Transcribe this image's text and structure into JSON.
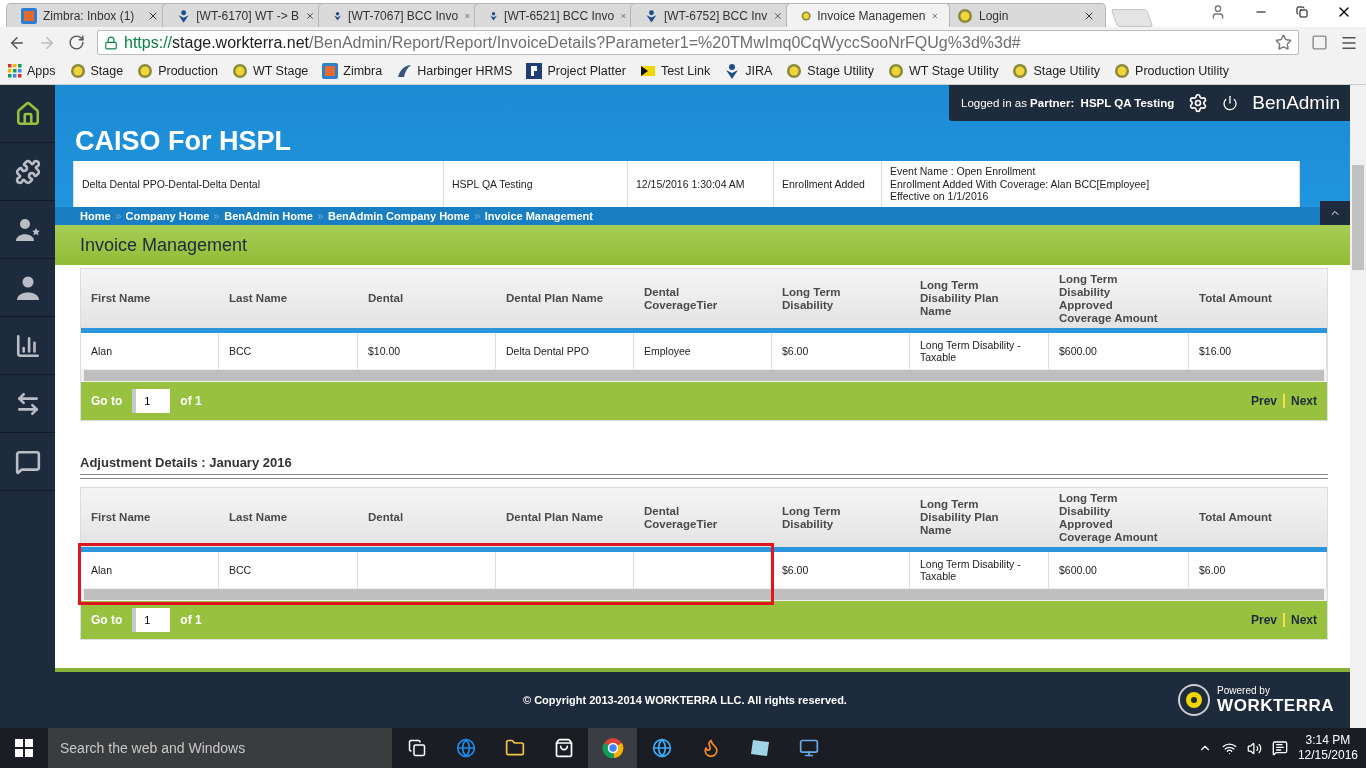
{
  "browser": {
    "tabs": [
      {
        "title": "Zimbra: Inbox (1)",
        "kind": "zimbra",
        "selected": false
      },
      {
        "title": "[WT-6170] WT -> B",
        "kind": "jira",
        "selected": false
      },
      {
        "title": "[WT-7067] BCC Invo",
        "kind": "jira",
        "selected": false
      },
      {
        "title": "[WT-6521] BCC Invo",
        "kind": "jira",
        "selected": false
      },
      {
        "title": "[WT-6752] BCC Inv",
        "kind": "jira",
        "selected": false
      },
      {
        "title": "Invoice Managemen",
        "kind": "site",
        "selected": true
      },
      {
        "title": "Login",
        "kind": "site",
        "selected": false
      }
    ],
    "url": {
      "scheme": "https://",
      "host": "stage.workterra.net",
      "path": "/BenAdmin/Report/Report/InvoiceDetails?Parameter1=%20TMwImq0CqWyccSooNrFQUg%3d%3d#"
    },
    "bookmarks": [
      {
        "label": "Apps",
        "kind": "apps"
      },
      {
        "label": "Stage",
        "kind": "site"
      },
      {
        "label": "Production",
        "kind": "site"
      },
      {
        "label": "WT Stage",
        "kind": "site"
      },
      {
        "label": "Zimbra",
        "kind": "zimbra"
      },
      {
        "label": "Harbinger HRMS",
        "kind": "harbinger"
      },
      {
        "label": "Project Platter",
        "kind": "letter"
      },
      {
        "label": "Test Link",
        "kind": "testlink"
      },
      {
        "label": "JIRA",
        "kind": "jira"
      },
      {
        "label": "Stage Utility",
        "kind": "site"
      },
      {
        "label": "WT Stage Utility",
        "kind": "site"
      },
      {
        "label": "Stage Utility",
        "kind": "site"
      },
      {
        "label": "Production Utility",
        "kind": "site"
      }
    ]
  },
  "sidebar": {
    "items": [
      {
        "kind": "home",
        "selected": true
      },
      {
        "kind": "puzzle",
        "selected": false
      },
      {
        "kind": "user-star",
        "selected": false
      },
      {
        "kind": "user",
        "selected": false
      },
      {
        "kind": "chart",
        "selected": false
      },
      {
        "kind": "transfer",
        "selected": false
      },
      {
        "kind": "chat",
        "selected": false
      }
    ]
  },
  "header": {
    "site_title": "CAISO For HSPL",
    "login_prefix": "Logged in as",
    "login_role": "Partner:",
    "login_name": "HSPL QA Testing",
    "app_name": "BenAdmin"
  },
  "notification": {
    "cells": [
      [
        "Delta Dental PPO-Dental-Delta Dental"
      ],
      [
        "HSPL QA Testing"
      ],
      [
        "12/15/2016 1:30:04 AM"
      ],
      [
        "Enrollment Added"
      ],
      [
        "Event Name : Open Enrollment",
        "Enrollment Added With Coverage: Alan BCC[Employee]",
        "Effective on 1/1/2016"
      ]
    ]
  },
  "breadcrumb": [
    "Home",
    "Company Home",
    "BenAdmin Home",
    "BenAdmin Company Home",
    "Invoice Management"
  ],
  "section_title": "Invoice Management",
  "invoice_table": {
    "columns": [
      "First Name",
      "Last Name",
      "Dental",
      "Dental Plan Name",
      "Dental CoverageTier",
      "Long Term Disability",
      "Long Term Disability Plan Name",
      "Long Term Disability Approved Coverage Amount",
      "Total Amount"
    ],
    "rows": [
      {
        "highlighted": false,
        "cells": [
          "Alan",
          "BCC",
          "$10.00",
          "Delta Dental PPO",
          "Employee",
          "$6.00",
          "Long Term Disability - Taxable",
          "$600.00",
          "$16.00"
        ]
      }
    ],
    "pager": {
      "goto_label": "Go to",
      "page": "1",
      "of_label": "of 1",
      "prev": "Prev",
      "next": "Next"
    }
  },
  "adjustment": {
    "title": "Adjustment Details : January 2016",
    "table": {
      "columns": [
        "First Name",
        "Last Name",
        "Dental",
        "Dental Plan Name",
        "Dental CoverageTier",
        "Long Term Disability",
        "Long Term Disability Plan Name",
        "Long Term Disability Approved Coverage Amount",
        "Total Amount"
      ],
      "rows": [
        {
          "highlighted": true,
          "cells": [
            "Alan",
            "BCC",
            "",
            "",
            "",
            "$6.00",
            "Long Term Disability - Taxable",
            "$600.00",
            "$6.00"
          ]
        }
      ],
      "pager": {
        "goto_label": "Go to",
        "page": "1",
        "of_label": "of 1",
        "prev": "Prev",
        "next": "Next"
      }
    }
  },
  "footer": {
    "copyright": "© Copyright 2013-2014 WORKTERRA LLC. All rights reserved.",
    "powered_label": "Powered by",
    "powered_brand": "WORKTERRA"
  },
  "taskbar": {
    "search_placeholder": "Search the web and Windows",
    "time": "3:14 PM",
    "date": "12/15/2016"
  }
}
